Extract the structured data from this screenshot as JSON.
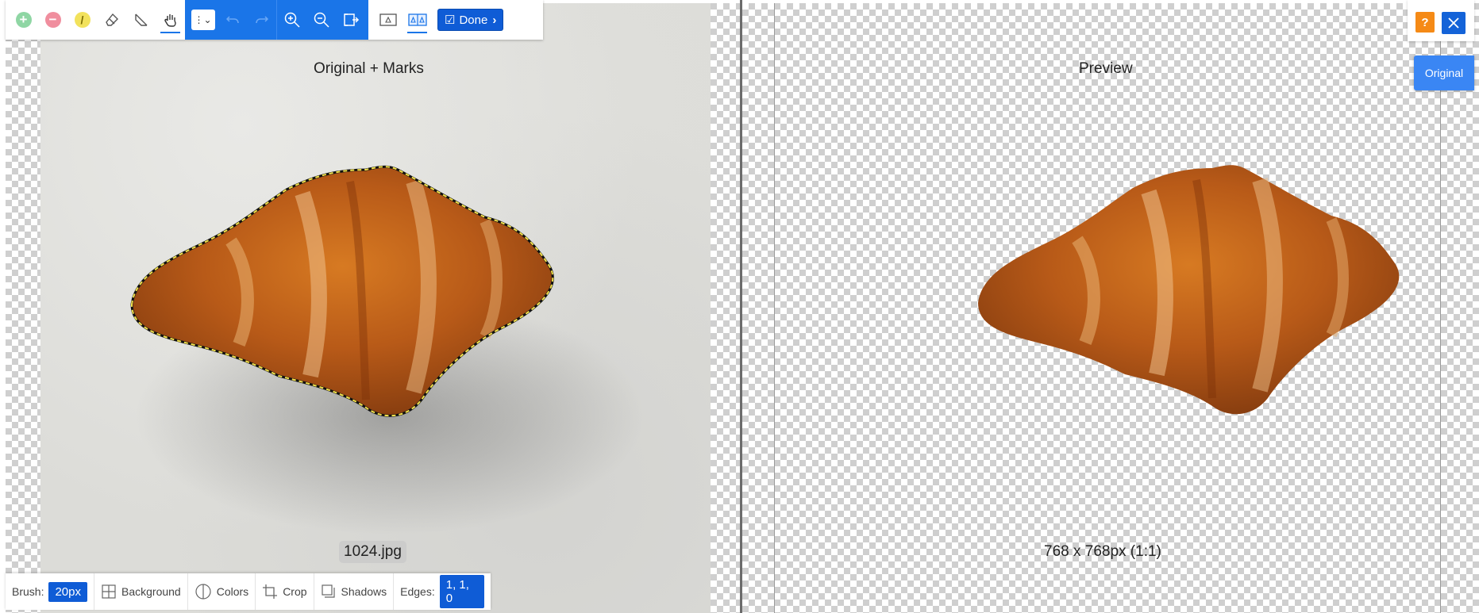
{
  "toolbar": {
    "tools": [
      {
        "name": "add-mark-tool",
        "color": "#8fd6a4"
      },
      {
        "name": "remove-mark-tool",
        "color": "#f08e9e"
      },
      {
        "name": "hair-tool",
        "color": "#f2e25c"
      }
    ],
    "done_label": "Done"
  },
  "left_pane": {
    "title": "Original + Marks",
    "filename": "1024.jpg"
  },
  "right_pane": {
    "title": "Preview",
    "dimensions": "768 x 768px (1:1)"
  },
  "bottom_bar": {
    "brush_label": "Brush:",
    "brush_value": "20px",
    "background_label": "Background",
    "colors_label": "Colors",
    "crop_label": "Crop",
    "shadows_label": "Shadows",
    "edges_label": "Edges:",
    "edges_value": "1, 1, 0"
  },
  "top_right": {
    "help_label": "?",
    "original_label": "Original"
  },
  "colors": {
    "accent_blue": "#1a75e8",
    "help_orange": "#f58a16"
  }
}
